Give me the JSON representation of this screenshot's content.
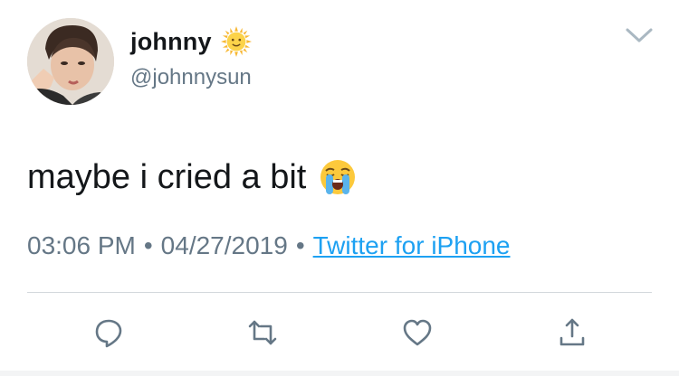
{
  "tweet": {
    "author": {
      "display_name": "johnny",
      "display_name_emoji": "sun-with-face-emoji",
      "handle": "@johnnysun"
    },
    "text": "maybe i cried a bit",
    "text_emoji": "loudly-crying-face-emoji",
    "time": "03:06 PM",
    "separator": "•",
    "date": "04/27/2019",
    "source": "Twitter for iPhone"
  },
  "actions": [
    {
      "icon": "reply-icon"
    },
    {
      "icon": "retweet-icon"
    },
    {
      "icon": "like-icon"
    },
    {
      "icon": "share-icon"
    }
  ],
  "colors": {
    "text_primary": "#14171a",
    "text_secondary": "#657786",
    "link": "#1da1f2",
    "icon": "#657786",
    "divider": "#d3d8dc"
  }
}
